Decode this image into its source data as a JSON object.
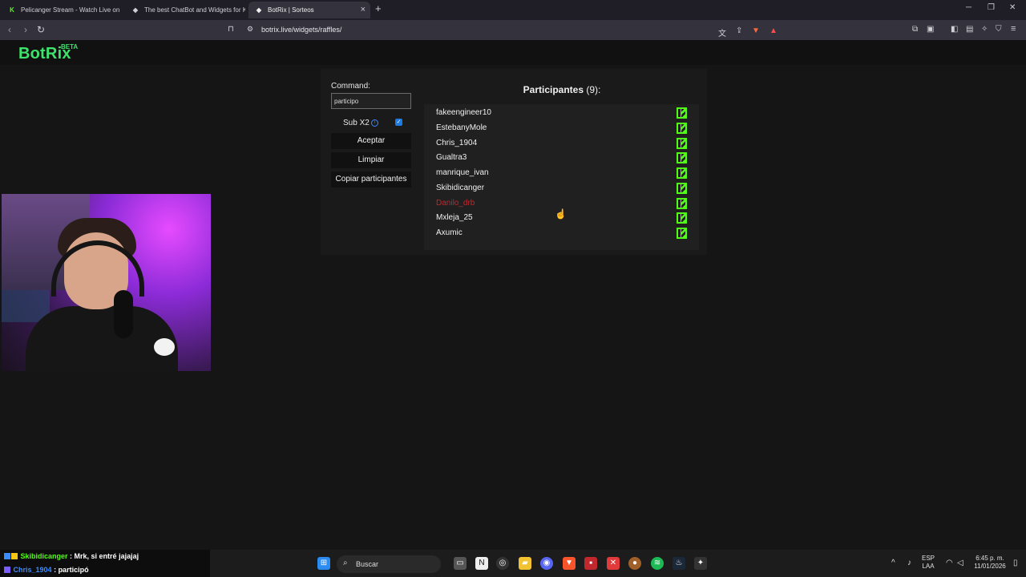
{
  "browser": {
    "tabs": [
      {
        "title": "Pelicanger Stream - Watch Live on Ki",
        "favicon": "K",
        "favicon_color": "#53fc18",
        "active": false
      },
      {
        "title": "The best ChatBot and Widgets for Ki",
        "favicon": "◆",
        "favicon_color": "#cfcfd6",
        "active": false
      },
      {
        "title": "BotRix | Sorteos",
        "favicon": "◆",
        "favicon_color": "#cfcfd6",
        "active": true
      }
    ],
    "url": "botrix.live/widgets/raffles/"
  },
  "site": {
    "logo": "BotRix",
    "logo_badge": "BETA",
    "accent_color": "#3ee36b"
  },
  "raffle": {
    "command_label": "Command:",
    "command_value": "participo",
    "sub_label": "Sub X2",
    "sub_checked": true,
    "accept_label": "Aceptar",
    "clear_label": "Limpiar",
    "copy_label": "Copiar participantes",
    "participants_title": "Participantes",
    "participants_count": "(9):",
    "participants": [
      {
        "name": "fakeengineer10",
        "removed": false
      },
      {
        "name": "EstebanyMole",
        "removed": false
      },
      {
        "name": "Chris_1904",
        "removed": false
      },
      {
        "name": "Gualtra3",
        "removed": false
      },
      {
        "name": "manrique_ivan",
        "removed": false
      },
      {
        "name": "Skibidicanger",
        "removed": false
      },
      {
        "name": "Danilo_drb",
        "removed": true
      },
      {
        "name": "Mxleja_25",
        "removed": false
      },
      {
        "name": "Axumic",
        "removed": false
      }
    ],
    "platform_icon": "kick-icon",
    "platform_color": "#53fc18"
  },
  "chat": [
    {
      "user": "Skibidicanger",
      "separator": " : ",
      "message": "Mrk, si entré jajajaj",
      "user_color": "#53fc18"
    },
    {
      "user": "Chris_1904",
      "separator": " : ",
      "message": "participó",
      "user_color": "#3a8bff"
    }
  ],
  "taskbar": {
    "search_placeholder": "Buscar",
    "lang_top": "ESP",
    "lang_bottom": "LAA",
    "time": "6:45 p. m.",
    "date": "11/01/2026"
  }
}
